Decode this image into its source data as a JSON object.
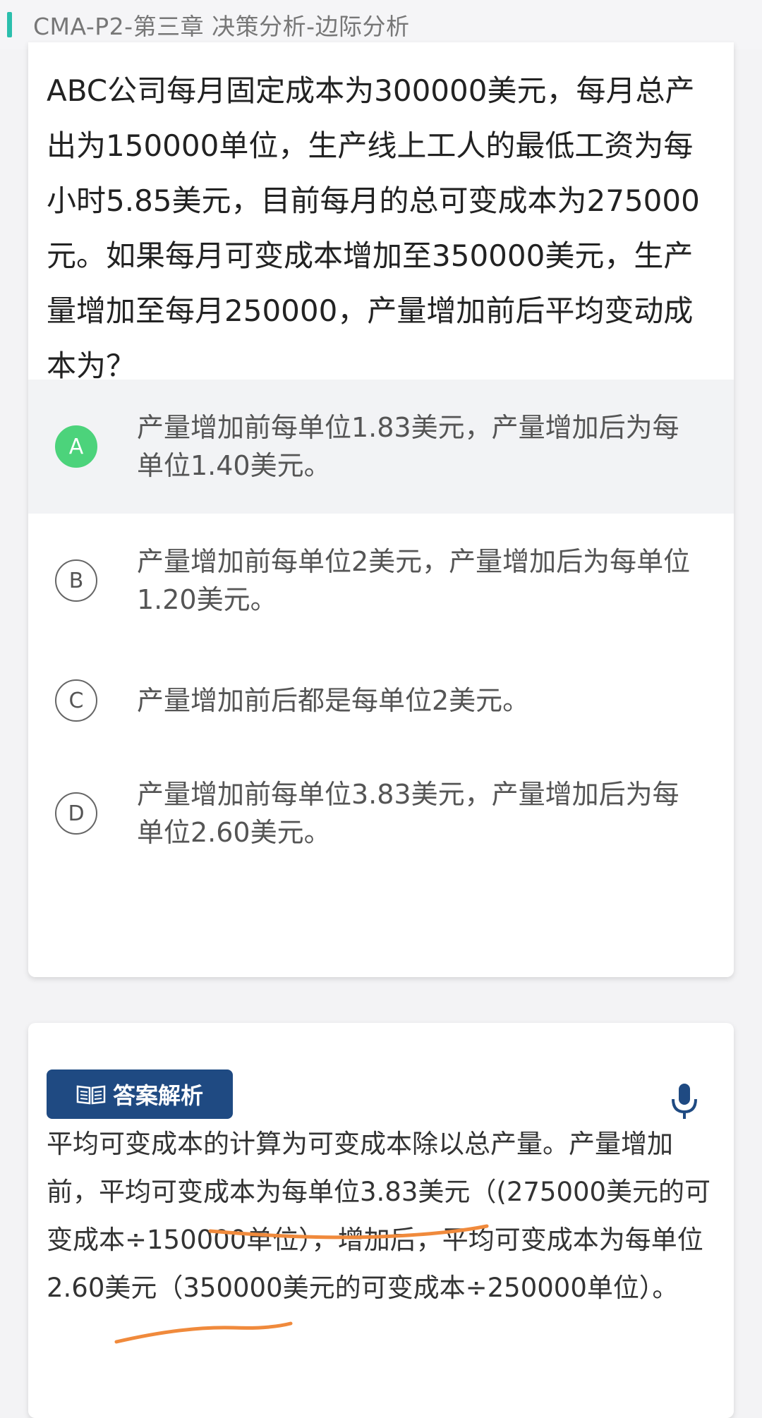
{
  "header": {
    "title": "CMA-P2-第三章  决策分析-边际分析"
  },
  "question": {
    "text": "ABC公司每月固定成本为300000美元，每月总产出为150000单位，生产线上工人的最低工资为每小时5.85美元，目前每月的总可变成本为275000元。如果每月可变成本增加至350000美元，生产量增加至每月250000，产量增加前后平均变动成本为？"
  },
  "options": [
    {
      "letter": "A",
      "text": "产量增加前每单位1.83美元，产量增加后为每单位1.40美元。"
    },
    {
      "letter": "B",
      "text": "产量增加前每单位2美元，产量增加后为每单位1.20美元。"
    },
    {
      "letter": "C",
      "text": " 产量增加前后都是每单位2美元。"
    },
    {
      "letter": "D",
      "text": "产量增加前每单位3.83美元，产量增加后为每单位2.60美元。"
    }
  ],
  "answer": {
    "header_label": "答案解析",
    "explanation": "平均可变成本的计算为可变成本除以总产量。产量增加前，平均可变成本为每单位3.83美元（(275000美元的可变成本÷150000单位），增加后，平均可变成本为每单位2.60美元（350000美元的可变成本÷250000单位）。"
  },
  "colors": {
    "accent": "#2bbfad",
    "selected_badge": "#4cd37b",
    "answer_header": "#1f4a82",
    "annotation": "#f08a3c"
  }
}
